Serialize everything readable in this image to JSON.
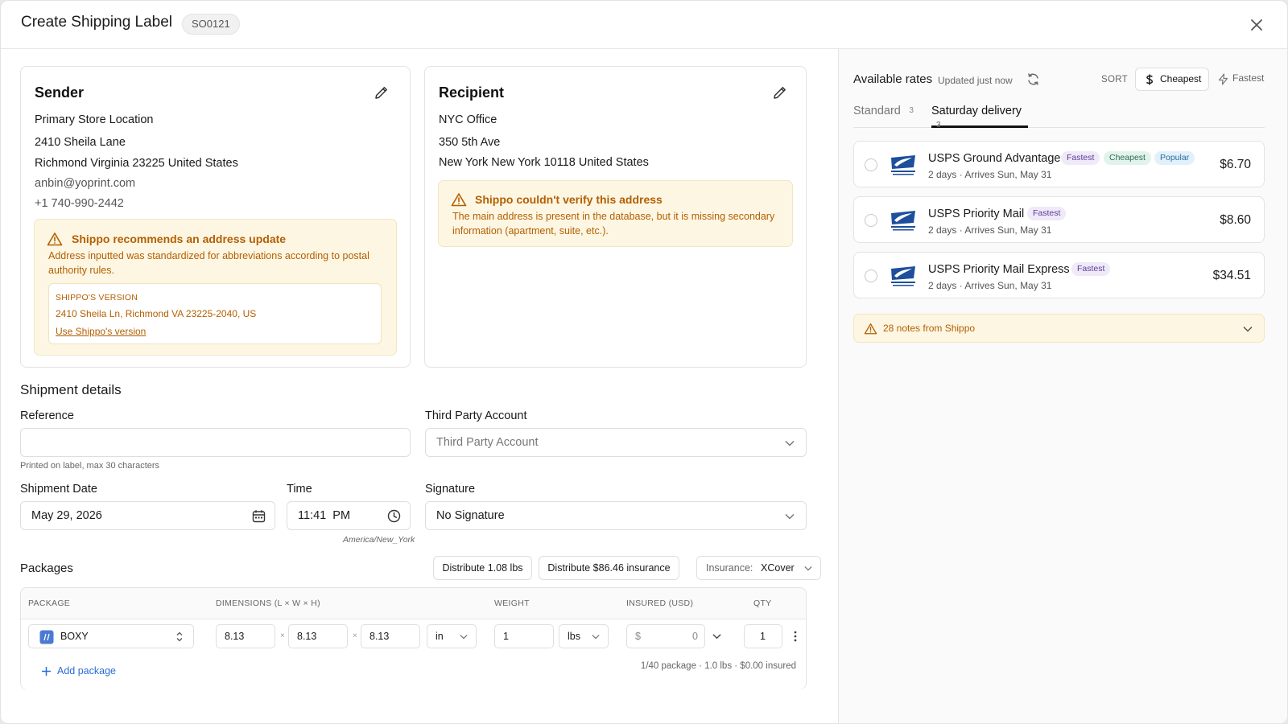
{
  "header": {
    "title": "Create Shipping Label",
    "order_id": "SO0121"
  },
  "sender": {
    "title": "Sender",
    "lines": [
      "Primary Store Location",
      "2410 Sheila Lane",
      "Richmond Virginia 23225 United States",
      "anbin@yoprint.com",
      "+1 740-990-2442"
    ],
    "warning": {
      "title": "Shippo recommends an address update",
      "body": "Address inputted was standardized for abbreviations according to postal authority rules.",
      "version_label": "SHIPPO'S VERSION",
      "version_value": "2410 Sheila Ln, Richmond VA 23225-2040, US",
      "use_link": "Use Shippo's version"
    }
  },
  "recipient": {
    "title": "Recipient",
    "lines": [
      "NYC Office",
      "350 5th Ave",
      "New York New York 10118 United States"
    ],
    "warning": {
      "title": "Shippo couldn't verify this address",
      "body": "The main address is present in the database, but it is missing secondary information (apartment, suite, etc.)."
    }
  },
  "shipment": {
    "title": "Shipment details",
    "reference_label": "Reference",
    "reference_value": "",
    "reference_hint": "Printed on label, max 30 characters",
    "third_party_label": "Third Party Account",
    "third_party_placeholder": "Third Party Account",
    "date_label": "Shipment Date",
    "date_value": "May 29, 2026",
    "time_label": "Time",
    "time_value": "11:41  PM",
    "timezone": "America/New_York",
    "signature_label": "Signature",
    "signature_value": "No Signature"
  },
  "packages": {
    "title": "Packages",
    "distribute_weight": "Distribute 1.08 lbs",
    "distribute_insurance": "Distribute $86.46 insurance",
    "insurance_label": "Insurance:",
    "insurance_value": "XCover",
    "columns": [
      "PACKAGE",
      "DIMENSIONS (L × W × H)",
      "WEIGHT",
      "INSURED (USD)",
      "QTY"
    ],
    "row": {
      "package": "BOXY",
      "length": "8.13",
      "width": "8.13",
      "height": "8.13",
      "dim_unit": "in",
      "weight": "1",
      "weight_unit": "lbs",
      "insured_prefix": "$",
      "insured": "0",
      "qty": "1"
    },
    "add_label": "Add package",
    "summary": "1/40 package · 1.0 lbs · $0.00 insured"
  },
  "rates": {
    "title": "Available rates",
    "updated": "Updated just now",
    "sort_label": "SORT",
    "sort_cheapest": "Cheapest",
    "sort_fastest": "Fastest",
    "tabs": [
      {
        "label": "Standard",
        "count": "3",
        "active": false
      },
      {
        "label": "Saturday delivery",
        "count": "3",
        "active": true
      }
    ],
    "items": [
      {
        "name": "USPS Ground Advantage",
        "days": "2 days",
        "arrival": "Arrives Sun, May 31",
        "price": "$6.70",
        "tags": [
          "Fastest",
          "Cheapest",
          "Popular"
        ]
      },
      {
        "name": "USPS Priority Mail",
        "days": "2 days",
        "arrival": "Arrives Sun, May 31",
        "price": "$8.60",
        "tags": [
          "Fastest"
        ]
      },
      {
        "name": "USPS Priority Mail Express",
        "days": "2 days",
        "arrival": "Arrives Sun, May 31",
        "price": "$34.51",
        "tags": [
          "Fastest"
        ]
      }
    ],
    "notes": "28 notes from Shippo"
  },
  "colors": {
    "warning_text": "#b35f00",
    "warning_bg": "#fdf6e3",
    "link_blue": "#2b6cd8",
    "usps_blue": "#1d4f9c"
  }
}
